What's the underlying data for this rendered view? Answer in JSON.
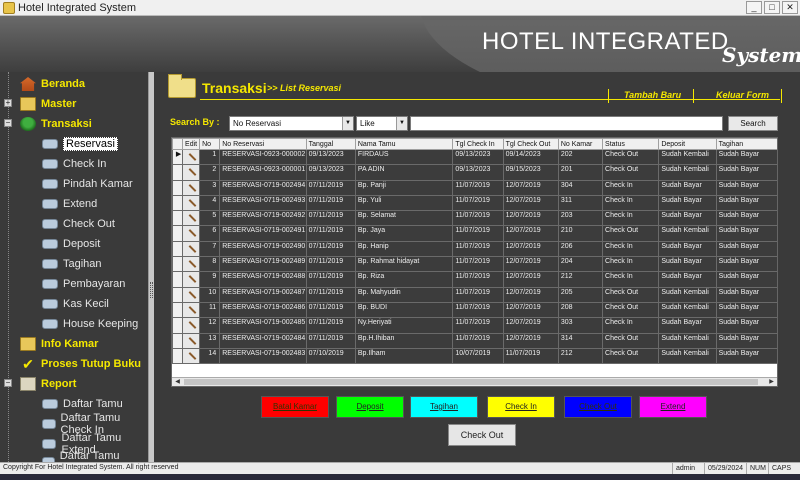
{
  "window": {
    "title": "Hotel Integrated System",
    "controls": [
      "_",
      "□",
      "✕"
    ]
  },
  "banner": {
    "brand": "HOTEL INTEGRATED",
    "brand_sub": "System"
  },
  "sidebar": {
    "items": [
      {
        "label": "Beranda",
        "icon": "home-icon"
      },
      {
        "label": "Master",
        "icon": "folder-icon"
      },
      {
        "label": "Transaksi",
        "icon": "tree-icon"
      }
    ],
    "transaksi_children": [
      "Reservasi",
      "Check In",
      "Pindah Kamar",
      "Extend",
      "Check Out",
      "Deposit",
      "Tagihan",
      "Pembayaran",
      "Kas Kecil",
      "House Keeping"
    ],
    "bottom_items": [
      {
        "label": "Info Kamar",
        "icon": "folder-icon"
      },
      {
        "label": "Proses Tutup Buku",
        "icon": "check-icon"
      },
      {
        "label": "Report",
        "icon": "report-icon"
      }
    ],
    "report_children": [
      "Daftar Tamu",
      "Daftar Tamu Check In",
      "Daftar Tamu Extend",
      "Daftar Tamu Check Out"
    ]
  },
  "main": {
    "title": "Transaksi",
    "subtitle": ">> List Reservasi",
    "tabs": {
      "new": "Tambah Baru",
      "exit": "Keluar Form"
    },
    "search": {
      "label": "Search By :",
      "field": "No Reservasi",
      "operator": "Like",
      "value": "",
      "button": "Search"
    }
  },
  "grid": {
    "columns": [
      "",
      "Edit",
      "No",
      "No Reservasi",
      "Tanggal",
      "Nama Tamu",
      "Tgl Check In",
      "Tgl Check Out",
      "No Kamar",
      "Status",
      "Deposit",
      "Tagihan"
    ],
    "rows": [
      [
        "1",
        "RESERVASI-0923-000002",
        "09/13/2023",
        "FIRDAUS",
        "09/13/2023",
        "09/14/2023",
        "202",
        "Check Out",
        "Sudah Kembali",
        "Sudah Bayar"
      ],
      [
        "2",
        "RESERVASI-0923-000001",
        "09/13/2023",
        "PA ADIN",
        "09/13/2023",
        "09/15/2023",
        "201",
        "Check Out",
        "Sudah Kembali",
        "Sudah Bayar"
      ],
      [
        "3",
        "RESERVASI-0719-002494",
        "07/11/2019",
        "Bp. Panji",
        "11/07/2019",
        "12/07/2019",
        "304",
        "Check In",
        "Sudah Bayar",
        "Sudah Bayar"
      ],
      [
        "4",
        "RESERVASI-0719-002493",
        "07/11/2019",
        "Bp. Yuli",
        "11/07/2019",
        "12/07/2019",
        "311",
        "Check In",
        "Sudah Bayar",
        "Sudah Bayar"
      ],
      [
        "5",
        "RESERVASI-0719-002492",
        "07/11/2019",
        "Bp. Selamat",
        "11/07/2019",
        "12/07/2019",
        "203",
        "Check In",
        "Sudah Bayar",
        "Sudah Bayar"
      ],
      [
        "6",
        "RESERVASI-0719-002491",
        "07/11/2019",
        "Bp. Jaya",
        "11/07/2019",
        "12/07/2019",
        "210",
        "Check Out",
        "Sudah Kembali",
        "Sudah Bayar"
      ],
      [
        "7",
        "RESERVASI-0719-002490",
        "07/11/2019",
        "Bp. Hanip",
        "11/07/2019",
        "12/07/2019",
        "206",
        "Check In",
        "Sudah Bayar",
        "Sudah Bayar"
      ],
      [
        "8",
        "RESERVASI-0719-002489",
        "07/11/2019",
        "Bp. Rahmat hidayat",
        "11/07/2019",
        "12/07/2019",
        "204",
        "Check In",
        "Sudah Bayar",
        "Sudah Bayar"
      ],
      [
        "9",
        "RESERVASI-0719-002488",
        "07/11/2019",
        "Bp. Riza",
        "11/07/2019",
        "12/07/2019",
        "212",
        "Check In",
        "Sudah Bayar",
        "Sudah Bayar"
      ],
      [
        "10",
        "RESERVASI-0719-002487",
        "07/11/2019",
        "Bp. Mahyudin",
        "11/07/2019",
        "12/07/2019",
        "205",
        "Check Out",
        "Sudah Kembali",
        "Sudah Bayar"
      ],
      [
        "11",
        "RESERVASI-0719-002486",
        "07/11/2019",
        "Bp. BUDI",
        "11/07/2019",
        "12/07/2019",
        "208",
        "Check Out",
        "Sudah Kembali",
        "Sudah Bayar"
      ],
      [
        "12",
        "RESERVASI-0719-002485",
        "07/11/2019",
        "Ny.Heriyati",
        "11/07/2019",
        "12/07/2019",
        "303",
        "Check In",
        "Sudah Bayar",
        "Sudah Bayar"
      ],
      [
        "13",
        "RESERVASI-0719-002484",
        "07/11/2019",
        "Bp.H.Ihiban",
        "11/07/2019",
        "12/07/2019",
        "314",
        "Check Out",
        "Sudah Kembali",
        "Sudah Bayar"
      ],
      [
        "14",
        "RESERVASI-0719-002483",
        "07/10/2019",
        "Bp.Ilham",
        "10/07/2019",
        "11/07/2019",
        "212",
        "Check Out",
        "Sudah Kembali",
        "Sudah Bayar"
      ]
    ]
  },
  "actions": [
    {
      "label": "Batal Kamar",
      "color": "#ff0000"
    },
    {
      "label": "Deposit",
      "color": "#00ff00"
    },
    {
      "label": "Tagihan",
      "color": "#00ffff"
    },
    {
      "label": "Check In",
      "color": "#ffff00"
    },
    {
      "label": "Check Out",
      "color": "#0000ff"
    },
    {
      "label": "Extend",
      "color": "#ff00ff"
    }
  ],
  "checkout_button": "Check Out",
  "statusbar": {
    "copyright": "Copyright For Hotel Integrated System. All right reserved",
    "user": "admin",
    "date": "05/29/2024",
    "num": "NUM",
    "caps": "CAPS"
  }
}
